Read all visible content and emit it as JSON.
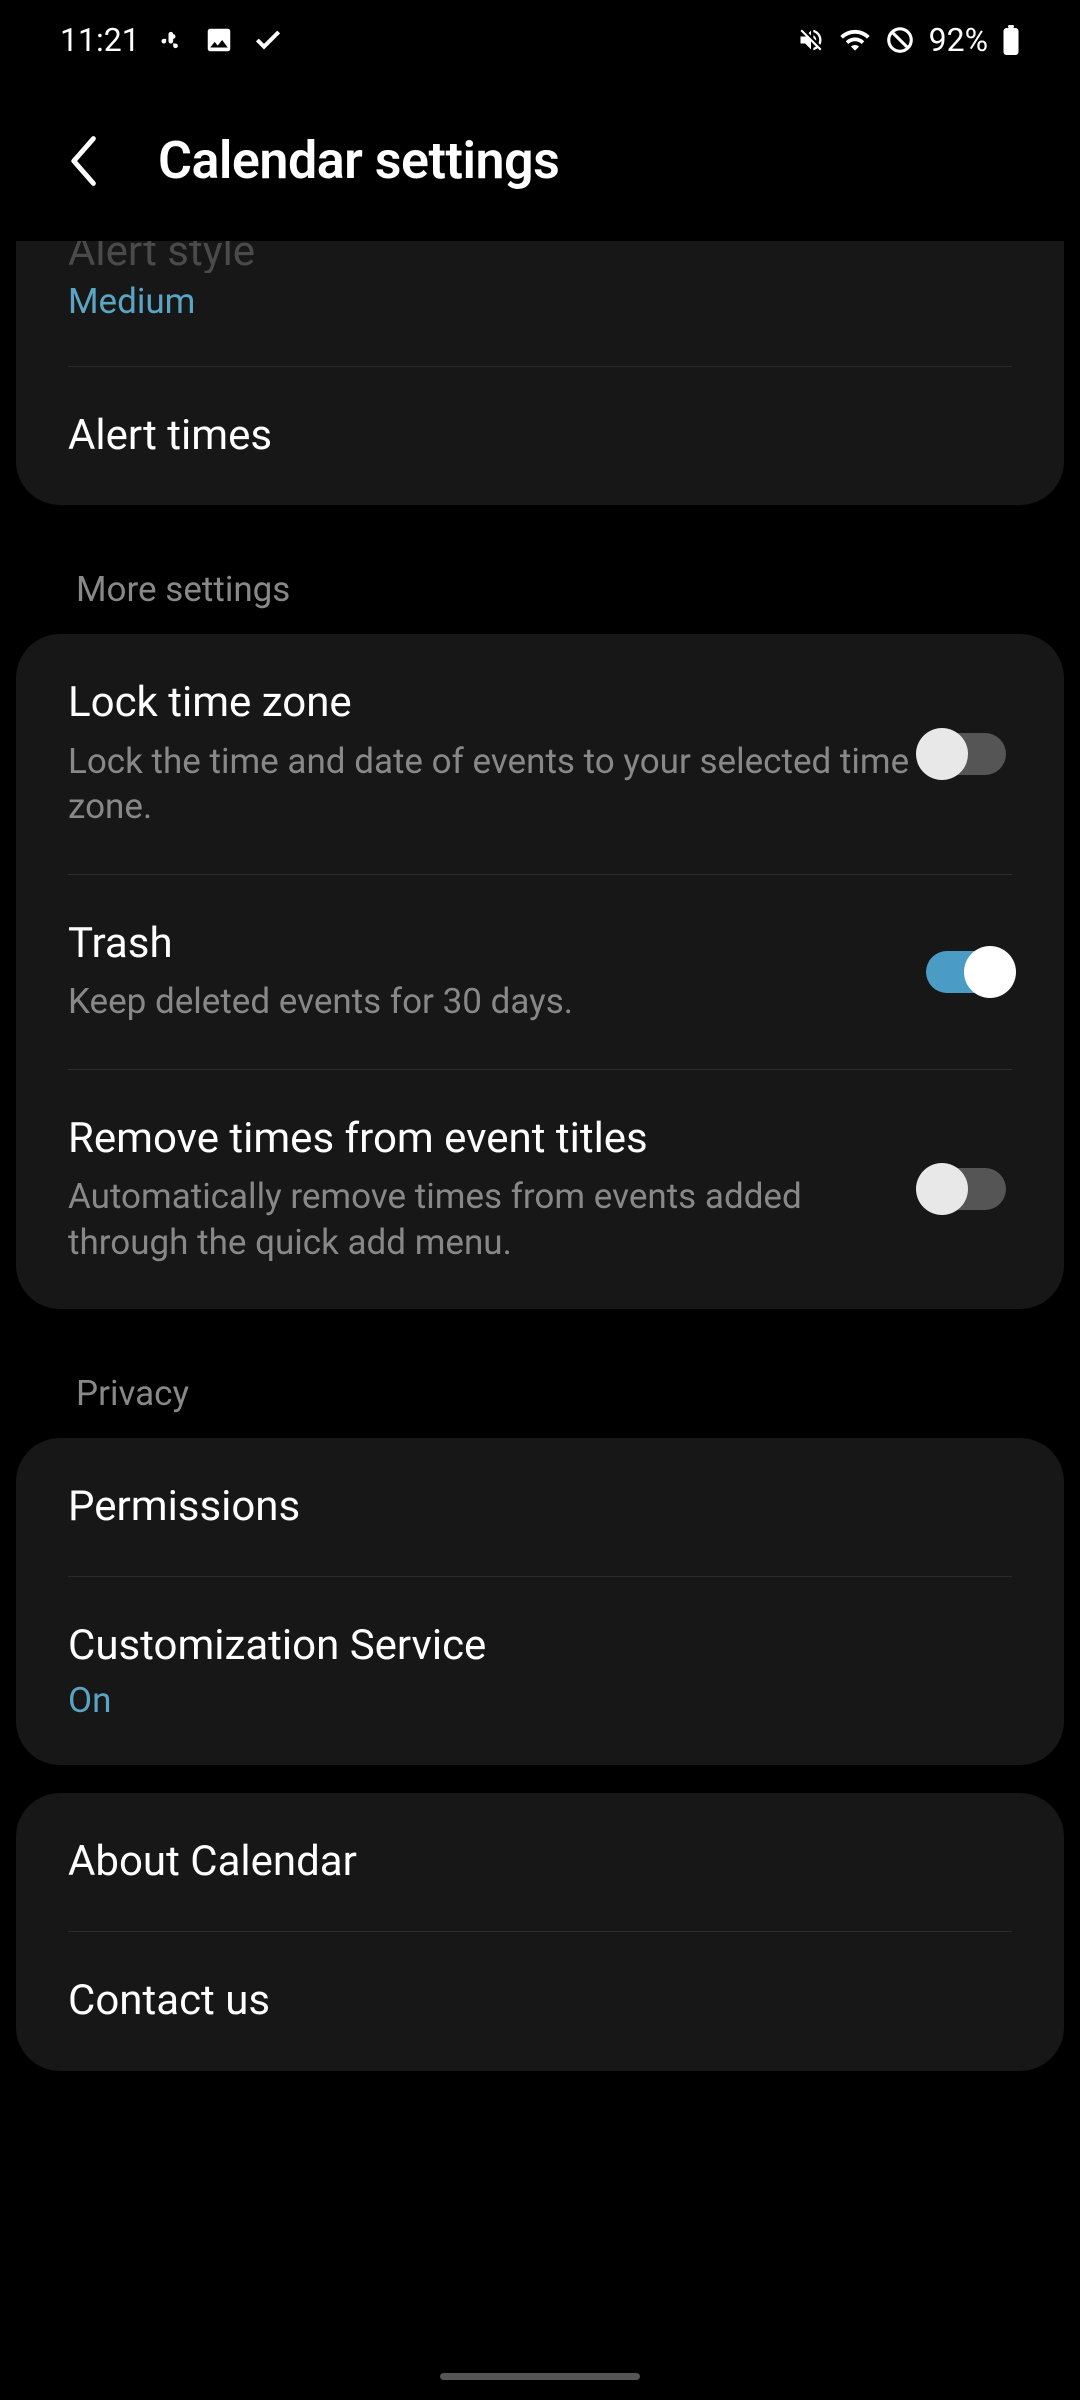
{
  "status_bar": {
    "time": "11:21",
    "battery": "92%"
  },
  "header": {
    "title": "Calendar settings"
  },
  "sections": {
    "alert_style": {
      "title": "Alert style",
      "value": "Medium"
    },
    "alert_times": {
      "title": "Alert times"
    },
    "more_settings_header": "More settings",
    "lock_timezone": {
      "title": "Lock time zone",
      "subtitle": "Lock the time and date of events to your selected time zone.",
      "enabled": false
    },
    "trash": {
      "title": "Trash",
      "subtitle": "Keep deleted events for 30 days.",
      "enabled": true
    },
    "remove_times": {
      "title": "Remove times from event titles",
      "subtitle": "Automatically remove times from events added through the quick add menu.",
      "enabled": false
    },
    "privacy_header": "Privacy",
    "permissions": {
      "title": "Permissions"
    },
    "customization": {
      "title": "Customization Service",
      "value": "On"
    },
    "about": {
      "title": "About Calendar"
    },
    "contact": {
      "title": "Contact us"
    }
  }
}
